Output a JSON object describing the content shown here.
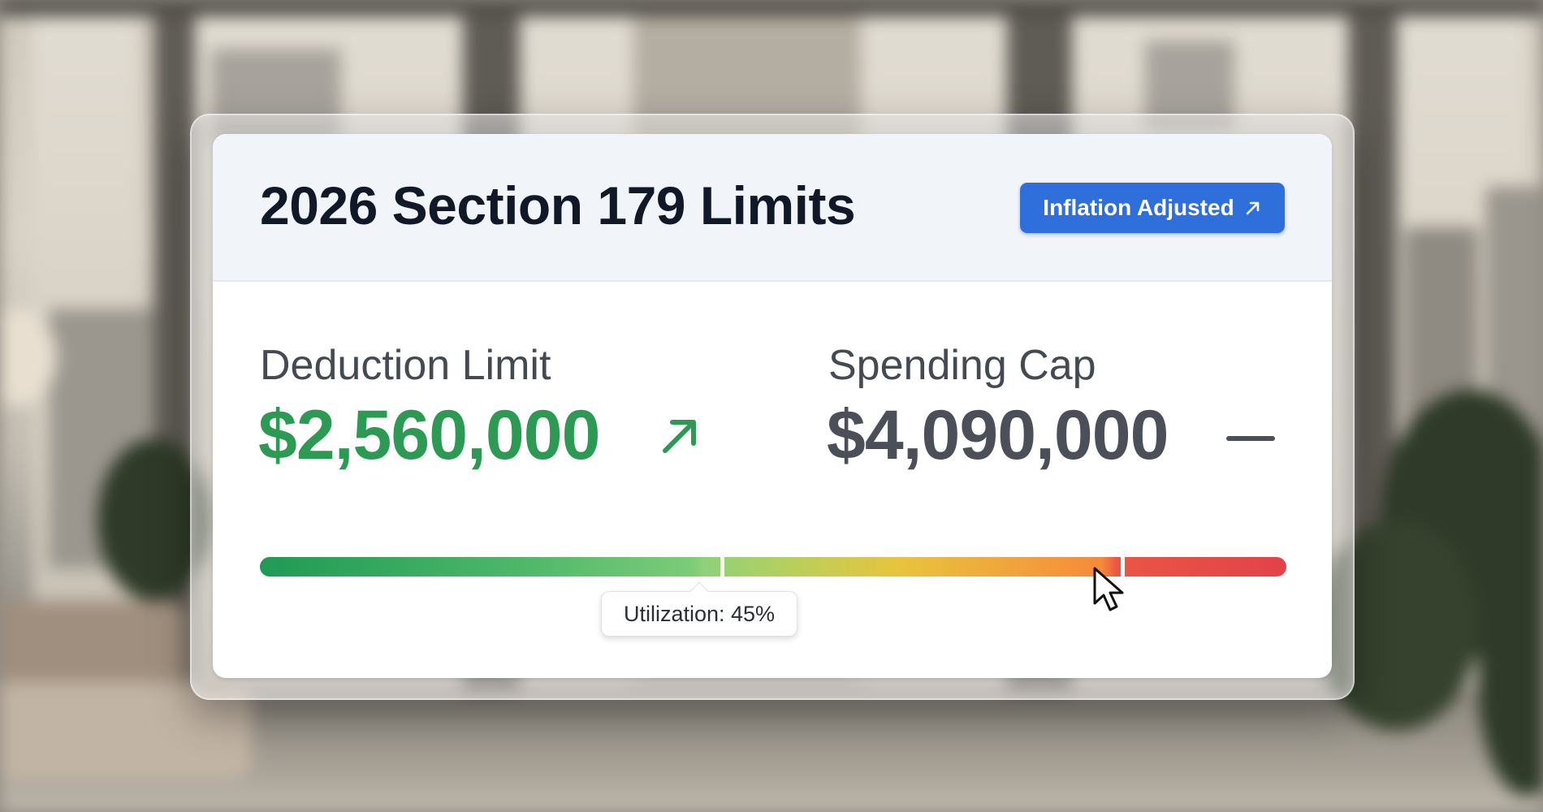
{
  "card": {
    "title": "2026 Section 179 Limits",
    "badge": {
      "label": "Inflation Adjusted",
      "icon": "arrow-up-right-icon",
      "color": "#2f6fdb"
    }
  },
  "metrics": {
    "deduction": {
      "label": "Deduction Limit",
      "value": "$2,560,000",
      "trend_icon": "arrow-up-right-icon",
      "trend": "up",
      "color": "#2c9a52"
    },
    "spending": {
      "label": "Spending Cap",
      "value": "$4,090,000",
      "trend_icon": "dash-icon",
      "trend": "flat",
      "color": "#4b5058"
    }
  },
  "utilization": {
    "tooltip_label": "Utilization: 45%",
    "value_pct": 45,
    "threshold_pct": 84,
    "gradient_stops": [
      "#1f9a55",
      "#8fd07a",
      "#e8c43e",
      "#f58a3a",
      "#e2424a"
    ]
  },
  "cursor_icon": "mouse-pointer-icon"
}
